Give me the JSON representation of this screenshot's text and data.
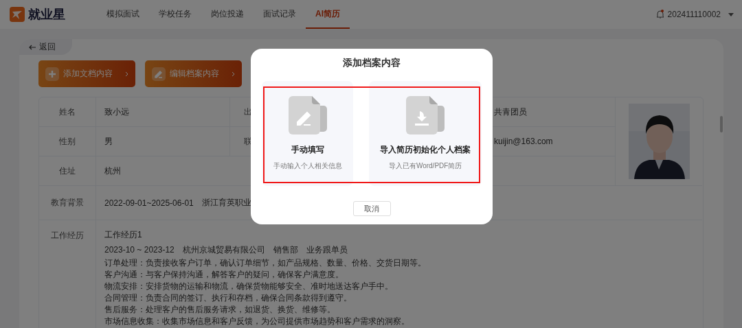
{
  "header": {
    "logo_text": "就业星",
    "nav": [
      {
        "label": "模拟面试",
        "selected": false
      },
      {
        "label": "学校任务",
        "selected": false
      },
      {
        "label": "岗位投递",
        "selected": false
      },
      {
        "label": "面试记录",
        "selected": false
      },
      {
        "label": "AI简历",
        "selected": true
      }
    ],
    "has_unread": true,
    "user": "202411110002"
  },
  "back_link": "返回",
  "actions": [
    {
      "label": "添加文档内容",
      "kind": "add"
    },
    {
      "label": "编辑档案内容",
      "kind": "edit"
    }
  ],
  "profile": {
    "rows": [
      {
        "label": "姓名",
        "value": "致小远",
        "label_2": "出",
        "value_2": "共青团员"
      },
      {
        "label": "性别",
        "value": "男",
        "label_2": "联",
        "value_2": "kuijin@163.com"
      },
      {
        "label": "住址",
        "value": "杭州"
      }
    ],
    "education": {
      "label": "教育背景",
      "period": "2022-09-01~2025-06-01",
      "school": "浙江育英职业"
    },
    "work": {
      "label": "工作经历",
      "title": "工作经历1",
      "period": "2023-10 ~ 2023-12",
      "company": "杭州京城贸易有限公司",
      "department": "销售部",
      "position": "业务跟单员",
      "duties": [
        "订单处理：负责接收客户订单，确认订单细节，如产品规格、数量、价格、交货日期等。",
        "客户沟通：与客户保持沟通，解答客户的疑问，确保客户满意度。",
        "物流安排：安排货物的运输和物流，确保货物能够安全、准时地送达客户手中。",
        "合同管理：负责合同的签订、执行和存档，确保合同条款得到遵守。",
        "售后服务：处理客户的售后服务请求，如退货、换货、维修等。",
        "市场信息收集：收集市场信息和客户反馈，为公司提供市场趋势和客户需求的洞察。"
      ]
    }
  },
  "modal": {
    "title": "添加档案内容",
    "options": [
      {
        "title": "手动填写",
        "description": "手动输入个人相关信息",
        "kind": "manual"
      },
      {
        "title": "导入简历初始化个人档案",
        "description": "导入已有Word/PDF简历",
        "kind": "import"
      }
    ],
    "highlighted": true,
    "cancel": "取消"
  }
}
